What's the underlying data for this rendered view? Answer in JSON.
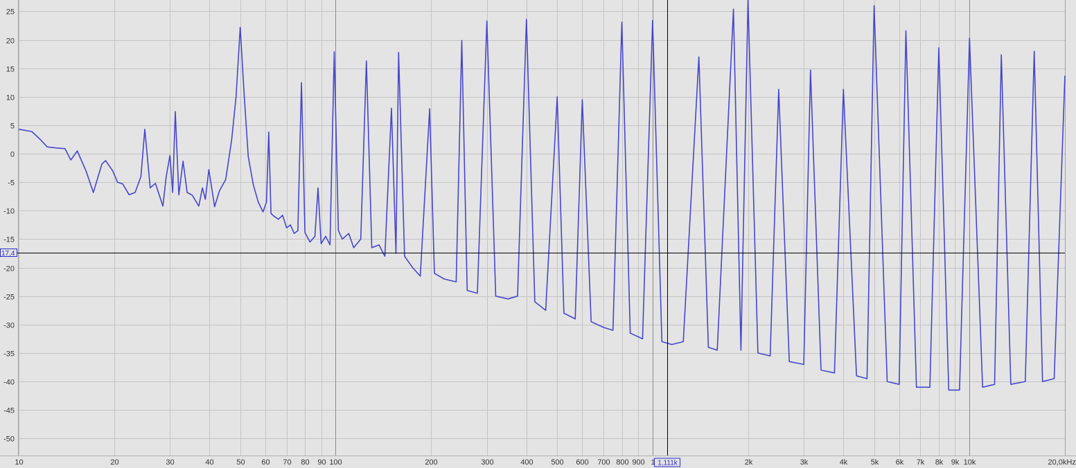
{
  "chart_data": {
    "type": "line",
    "title": "",
    "xlabel": "",
    "ylabel": "",
    "xscale": "log",
    "xlim": [
      10,
      20000
    ],
    "ylim": [
      -53,
      27
    ],
    "grid": true,
    "line_color": "#4646cc",
    "background": "#e4e4e4",
    "grid_color": "#c4c4c4",
    "y_ticks": [
      {
        "v": 25,
        "label": "25"
      },
      {
        "v": 20,
        "label": "20"
      },
      {
        "v": 15,
        "label": "15"
      },
      {
        "v": 10,
        "label": "10"
      },
      {
        "v": 5,
        "label": "5"
      },
      {
        "v": 0,
        "label": "0"
      },
      {
        "v": -5,
        "label": "-5"
      },
      {
        "v": -10,
        "label": "-10"
      },
      {
        "v": -15,
        "label": "-15"
      },
      {
        "v": -20,
        "label": "-20"
      },
      {
        "v": -25,
        "label": "-25"
      },
      {
        "v": -30,
        "label": "-30"
      },
      {
        "v": -35,
        "label": "-35"
      },
      {
        "v": -40,
        "label": "-40"
      },
      {
        "v": -45,
        "label": "-45"
      },
      {
        "v": -50,
        "label": "-50"
      }
    ],
    "x_ticks": [
      {
        "v": 10,
        "label": "10"
      },
      {
        "v": 20,
        "label": "20"
      },
      {
        "v": 30,
        "label": "30"
      },
      {
        "v": 40,
        "label": "40"
      },
      {
        "v": 50,
        "label": "50"
      },
      {
        "v": 60,
        "label": "60"
      },
      {
        "v": 70,
        "label": "70"
      },
      {
        "v": 80,
        "label": "80"
      },
      {
        "v": 90,
        "label": "90"
      },
      {
        "v": 100,
        "label": "100"
      },
      {
        "v": 200,
        "label": "200"
      },
      {
        "v": 300,
        "label": "300"
      },
      {
        "v": 400,
        "label": "400"
      },
      {
        "v": 500,
        "label": "500"
      },
      {
        "v": 600,
        "label": "600"
      },
      {
        "v": 700,
        "label": "700"
      },
      {
        "v": 800,
        "label": "800"
      },
      {
        "v": 900,
        "label": "900"
      },
      {
        "v": 1000,
        "label": "1"
      },
      {
        "v": 2000,
        "label": "2k"
      },
      {
        "v": 3000,
        "label": "3k"
      },
      {
        "v": 4000,
        "label": "4k"
      },
      {
        "v": 5000,
        "label": "5k"
      },
      {
        "v": 6000,
        "label": "6k"
      },
      {
        "v": 7000,
        "label": "7k"
      },
      {
        "v": 8000,
        "label": "8k"
      },
      {
        "v": 9000,
        "label": "9k"
      },
      {
        "v": 10000,
        "label": "10k"
      },
      {
        "v": 20000,
        "label": "20,0kHz"
      }
    ],
    "major_x_lines": [
      100,
      1000,
      10000
    ],
    "cursor": {
      "x": 1111,
      "y": -17.4,
      "x_label": "1,111k",
      "y_label": "17,4"
    },
    "series": [
      {
        "points": [
          [
            10,
            4.3
          ],
          [
            11,
            3.9
          ],
          [
            11.7,
            2.5
          ],
          [
            12.3,
            1.2
          ],
          [
            13.2,
            1.0
          ],
          [
            14.0,
            0.9
          ],
          [
            14.6,
            -1.1
          ],
          [
            15.3,
            0.5
          ],
          [
            16.3,
            -3.0
          ],
          [
            17.2,
            -6.8
          ],
          [
            18.3,
            -1.8
          ],
          [
            18.8,
            -1.2
          ],
          [
            19.8,
            -3.0
          ],
          [
            20.5,
            -5.0
          ],
          [
            21.3,
            -5.3
          ],
          [
            22.3,
            -7.2
          ],
          [
            23.3,
            -6.8
          ],
          [
            24.3,
            -4.0
          ],
          [
            25.0,
            4.3
          ],
          [
            26.0,
            -6.0
          ],
          [
            27.0,
            -5.2
          ],
          [
            28.5,
            -9.2
          ],
          [
            29.2,
            -4.0
          ],
          [
            30.0,
            -0.3
          ],
          [
            30.6,
            -6.8
          ],
          [
            31.2,
            7.4
          ],
          [
            32.0,
            -7.2
          ],
          [
            33.0,
            -1.3
          ],
          [
            34.0,
            -6.8
          ],
          [
            35.3,
            -7.3
          ],
          [
            37.0,
            -9.2
          ],
          [
            38.0,
            -6.0
          ],
          [
            38.8,
            -8.0
          ],
          [
            39.8,
            -2.8
          ],
          [
            40.5,
            -5.5
          ],
          [
            41.5,
            -9.3
          ],
          [
            43.0,
            -6.5
          ],
          [
            45.0,
            -4.5
          ],
          [
            47.0,
            2.5
          ],
          [
            48.5,
            10.0
          ],
          [
            50.0,
            22.2
          ],
          [
            51.5,
            10.0
          ],
          [
            53.0,
            -0.5
          ],
          [
            55.0,
            -5.5
          ],
          [
            57.0,
            -8.5
          ],
          [
            59.0,
            -10.2
          ],
          [
            60.5,
            -8.5
          ],
          [
            61.5,
            3.8
          ],
          [
            62.5,
            -10.5
          ],
          [
            64.0,
            -11.0
          ],
          [
            66.0,
            -11.5
          ],
          [
            68.0,
            -10.8
          ],
          [
            70.0,
            -13.0
          ],
          [
            72.0,
            -12.5
          ],
          [
            74.0,
            -14.0
          ],
          [
            76.0,
            -13.5
          ],
          [
            78.0,
            12.5
          ],
          [
            80.0,
            -13.8
          ],
          [
            83.0,
            -15.5
          ],
          [
            86.0,
            -14.5
          ],
          [
            88.0,
            -6.0
          ],
          [
            90.0,
            -15.8
          ],
          [
            93.0,
            -14.5
          ],
          [
            96.0,
            -16.0
          ],
          [
            99.0,
            17.9
          ],
          [
            102.0,
            -13.5
          ],
          [
            105.0,
            -15.0
          ],
          [
            110.0,
            -14.0
          ],
          [
            114.0,
            -16.5
          ],
          [
            120.0,
            -15.0
          ],
          [
            125.0,
            16.3
          ],
          [
            130.0,
            -16.5
          ],
          [
            137.0,
            -16.0
          ],
          [
            143.0,
            -18.0
          ],
          [
            150.0,
            8.0
          ],
          [
            155.0,
            -17.5
          ],
          [
            158.0,
            17.8
          ],
          [
            165.0,
            -18.0
          ],
          [
            175.0,
            -20.0
          ],
          [
            185.0,
            -21.5
          ],
          [
            198.0,
            7.9
          ],
          [
            205.0,
            -21.0
          ],
          [
            220.0,
            -22.0
          ],
          [
            240.0,
            -22.5
          ],
          [
            250.0,
            19.9
          ],
          [
            260.0,
            -24.0
          ],
          [
            280.0,
            -24.5
          ],
          [
            300.0,
            23.3
          ],
          [
            320.0,
            -25.0
          ],
          [
            350.0,
            -25.5
          ],
          [
            375.0,
            -25.0
          ],
          [
            400.0,
            23.6
          ],
          [
            425.0,
            -26.0
          ],
          [
            460.0,
            -27.5
          ],
          [
            500.0,
            10.0
          ],
          [
            525.0,
            -28.0
          ],
          [
            570.0,
            -29.0
          ],
          [
            600.0,
            9.5
          ],
          [
            640.0,
            -29.5
          ],
          [
            700.0,
            -30.5
          ],
          [
            750.0,
            -31.0
          ],
          [
            800.0,
            23.1
          ],
          [
            850.0,
            -31.5
          ],
          [
            930.0,
            -32.5
          ],
          [
            1000.0,
            23.4
          ],
          [
            1070.0,
            -33.0
          ],
          [
            1150.0,
            -33.5
          ],
          [
            1250.0,
            -33.0
          ],
          [
            1400.0,
            17.0
          ],
          [
            1500.0,
            -34.0
          ],
          [
            1600.0,
            -34.5
          ],
          [
            1800.0,
            25.4
          ],
          [
            1900.0,
            -34.5
          ],
          [
            2000.0,
            27.0
          ],
          [
            2150.0,
            -35.0
          ],
          [
            2350.0,
            -35.5
          ],
          [
            2500.0,
            11.3
          ],
          [
            2700.0,
            -36.5
          ],
          [
            3000.0,
            -37.0
          ],
          [
            3150.0,
            14.7
          ],
          [
            3400.0,
            -38.0
          ],
          [
            3750.0,
            -38.5
          ],
          [
            4000.0,
            11.3
          ],
          [
            4400.0,
            -39.0
          ],
          [
            4750.0,
            -39.5
          ],
          [
            5000.0,
            26.0
          ],
          [
            5500.0,
            -40.0
          ],
          [
            6000.0,
            -40.5
          ],
          [
            6300.0,
            21.6
          ],
          [
            6800.0,
            -41.0
          ],
          [
            7500.0,
            -41.0
          ],
          [
            8000.0,
            18.6
          ],
          [
            8600.0,
            -41.5
          ],
          [
            9300.0,
            -41.5
          ],
          [
            10000.0,
            20.3
          ],
          [
            11000.0,
            -41.0
          ],
          [
            12000.0,
            -40.5
          ],
          [
            12600.0,
            17.4
          ],
          [
            13500.0,
            -40.5
          ],
          [
            15000.0,
            -40.0
          ],
          [
            16000.0,
            18.0
          ],
          [
            17000.0,
            -40.0
          ],
          [
            18500.0,
            -39.5
          ],
          [
            20000.0,
            13.7
          ]
        ]
      }
    ]
  }
}
